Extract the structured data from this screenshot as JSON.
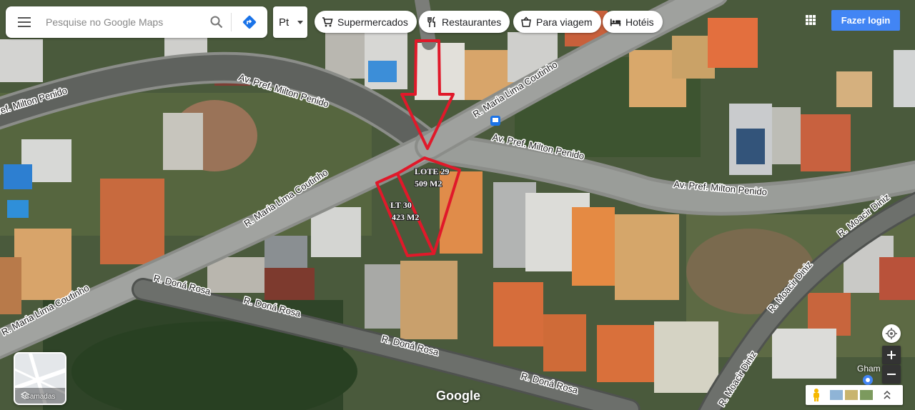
{
  "search": {
    "placeholder": "Pesquise no Google Maps",
    "value": ""
  },
  "language": {
    "selected": "Pt"
  },
  "categories": [
    {
      "label": "Supermercados",
      "icon": "cart-icon"
    },
    {
      "label": "Restaurantes",
      "icon": "fork-knife-icon"
    },
    {
      "label": "Para viagem",
      "icon": "takeout-bag-icon"
    },
    {
      "label": "Hotéis",
      "icon": "bed-icon"
    }
  ],
  "header": {
    "login_label": "Fazer login"
  },
  "map": {
    "roads": [
      {
        "name": "Av. Pref. Milton Penido",
        "id": "av-pref-milton-penido"
      },
      {
        "name": "R. Maria Lima Coutinho",
        "id": "r-maria-lima-coutinho"
      },
      {
        "name": "R. Doná Rosa",
        "id": "r-dona-rosa"
      },
      {
        "name": "R. Moacir Diniz",
        "id": "r-moacir-diniz"
      }
    ],
    "labels": {
      "milton_a": "Av. Pref. Milton Penido",
      "milton_b": "Av. Pref. Milton Penido",
      "milton_c": "Av. Pref. Milton Penido",
      "milton_d": "ref. Milton Penido",
      "maria_a": "R. Maria Lima Coutinho",
      "maria_b": "R. Maria Lima Coutinho",
      "maria_c": "R. Maria Lima Coutinho",
      "dona_a": "R. Doná Rosa",
      "dona_b": "R. Doná Rosa",
      "dona_c": "R. Doná Rosa",
      "dona_d": "R. Doná Rosa",
      "moacir_a": "R. Moacir Diniz",
      "moacir_b": "R. Moacir Diniz",
      "moacir_c": "R. Moacir Diniz"
    },
    "lots": [
      {
        "name": "LOTE 29",
        "area": "509 M2"
      },
      {
        "name": "LT 30",
        "area": "423 M2"
      }
    ],
    "annotation_color": "#e0192a",
    "city_label": "Gham"
  },
  "layers": {
    "label": "Camadas"
  },
  "brand": {
    "logo_text": "Google"
  },
  "colors": {
    "accent": "#4285f4",
    "marker": "#e0192a"
  }
}
